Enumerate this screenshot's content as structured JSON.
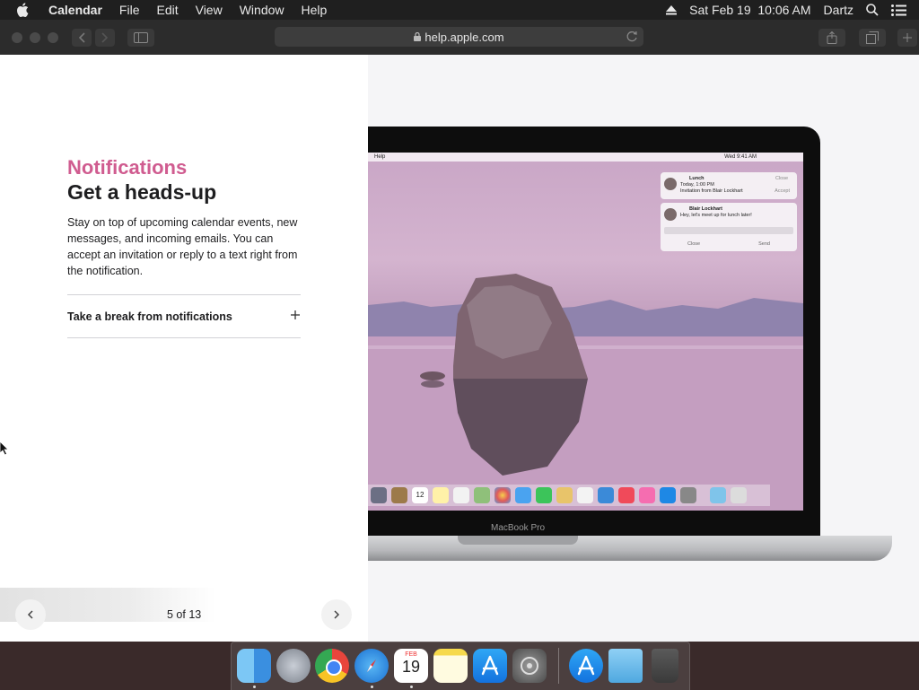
{
  "menubar": {
    "app_name": "Calendar",
    "items": [
      "File",
      "Edit",
      "View",
      "Window",
      "Help"
    ],
    "datetime": "Sat Feb 19  10:06 AM",
    "user": "Dartz"
  },
  "browser": {
    "url": "help.apple.com"
  },
  "article": {
    "eyebrow": "Notifications",
    "headline": "Get a heads-up",
    "body": "Stay on top of upcoming calendar events, new messages, and incoming emails. You can accept an invitation or reply to a text right from the notification.",
    "accordion_label": "Take a break from notifications",
    "pager": "5 of 13"
  },
  "illustration": {
    "device_label": "MacBook Pro",
    "mini_menubar_app": "Help",
    "mini_menubar_time": "Wed 9:41 AM",
    "notification_1": {
      "title": "Lunch",
      "time": "Today, 1:00 PM",
      "detail": "Invitation from Blair Lockhart",
      "action_1": "Close",
      "action_2": "Accept"
    },
    "notification_2": {
      "sender": "Blair Lockhart",
      "message": "Hey, let's meet up for lunch later!",
      "action_1": "Close",
      "action_2": "Send"
    },
    "dock_calendar_day": "12"
  },
  "dock": {
    "calendar_month": "FEB",
    "calendar_day": "19"
  },
  "colors": {
    "accent_pink": "#d05c90",
    "menubar_bg": "#1f1f1f",
    "toolbar_bg": "#2c2c2c"
  }
}
